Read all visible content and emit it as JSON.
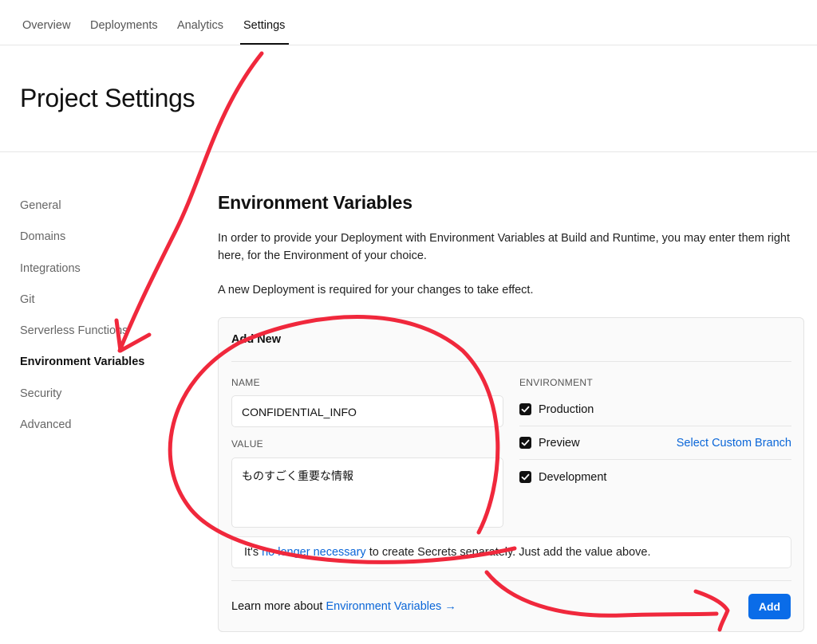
{
  "topnav": {
    "tabs": [
      "Overview",
      "Deployments",
      "Analytics",
      "Settings"
    ],
    "active_tab": "Settings"
  },
  "header": {
    "title": "Project Settings"
  },
  "sidebar": {
    "items": [
      "General",
      "Domains",
      "Integrations",
      "Git",
      "Serverless Functions",
      "Environment Variables",
      "Security",
      "Advanced"
    ],
    "active": "Environment Variables"
  },
  "main": {
    "title": "Environment Variables",
    "description": "In order to provide your Deployment with Environment Variables at Build and Runtime, you may enter them right here, for the Environment of your choice.",
    "note": "A new Deployment is required for your changes to take effect."
  },
  "add_new": {
    "title": "Add New",
    "name_label": "NAME",
    "name_value": "CONFIDENTIAL_INFO",
    "value_label": "VALUE",
    "value_value": "ものすごく重要な情報",
    "environment_label": "ENVIRONMENT",
    "environments": [
      {
        "label": "Production",
        "checked": true
      },
      {
        "label": "Preview",
        "checked": true
      },
      {
        "label": "Development",
        "checked": true
      }
    ],
    "custom_branch_link": "Select Custom Branch",
    "notice_prefix": "It's",
    "notice_link": "no longer necessary",
    "notice_suffix": "to create Secrets separately. Just add the value above.",
    "learn_prefix": "Learn more about",
    "learn_link": "Environment Variables →",
    "add_label": "Add"
  },
  "colors": {
    "accent": "#0a6ce8",
    "link": "#0a66d8",
    "annotation": "#f0283c"
  }
}
